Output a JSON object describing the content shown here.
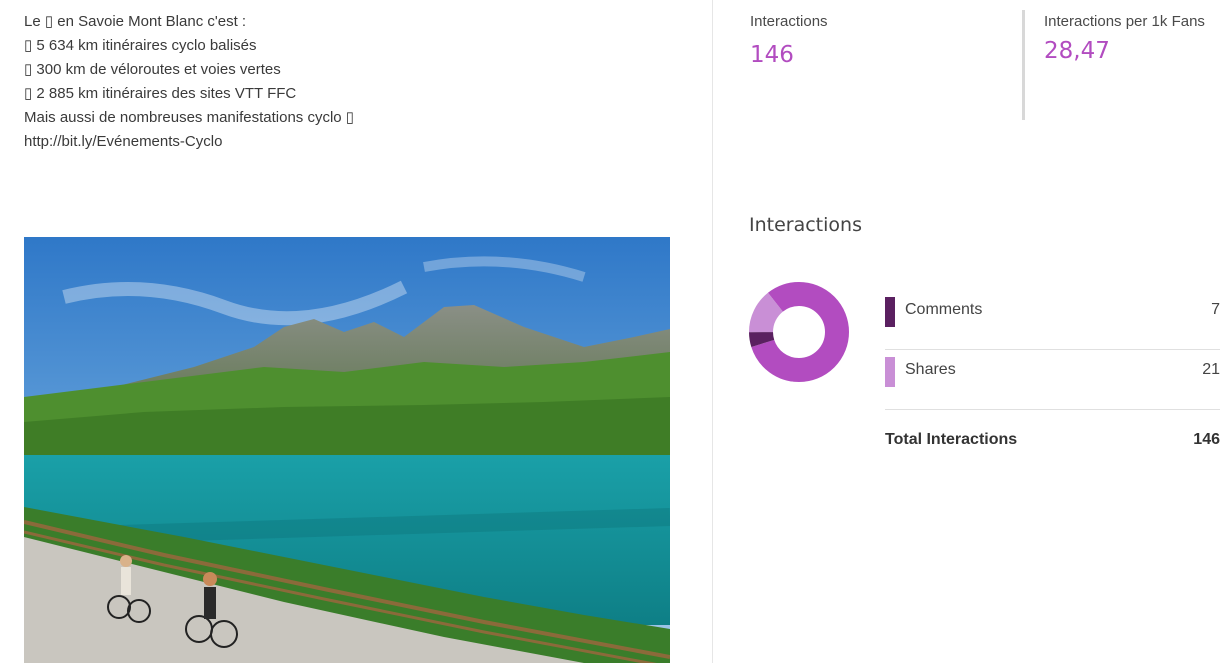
{
  "post": {
    "lines": [
      "Le ▯ en Savoie Mont Blanc c'est :",
      "▯ 5 634 km itinéraires cyclo balisés",
      "▯ 300 km de véloroutes et voies vertes",
      "▯ 2 885 km itinéraires des sites VTT FFC",
      "Mais aussi de nombreuses manifestations cyclo ▯",
      "http://bit.ly/Evénements-Cyclo"
    ]
  },
  "metrics": {
    "interactions_label": "Interactions",
    "interactions_value": "146",
    "per1k_label": "Interactions per 1k Fans",
    "per1k_value": "28,47"
  },
  "breakdown": {
    "title": "Interactions",
    "items": [
      {
        "label": "Comments",
        "value": "7",
        "color": "#5a2060"
      },
      {
        "label": "Shares",
        "value": "21",
        "color": "#c98fd6"
      }
    ],
    "total_label": "Total Interactions",
    "total_value": "146",
    "main_color": "#b24cc0",
    "donut_fractions": {
      "comments": 0.048,
      "shares": 0.144,
      "other": 0.808
    }
  },
  "colors": {
    "accent": "#b24cc0"
  }
}
